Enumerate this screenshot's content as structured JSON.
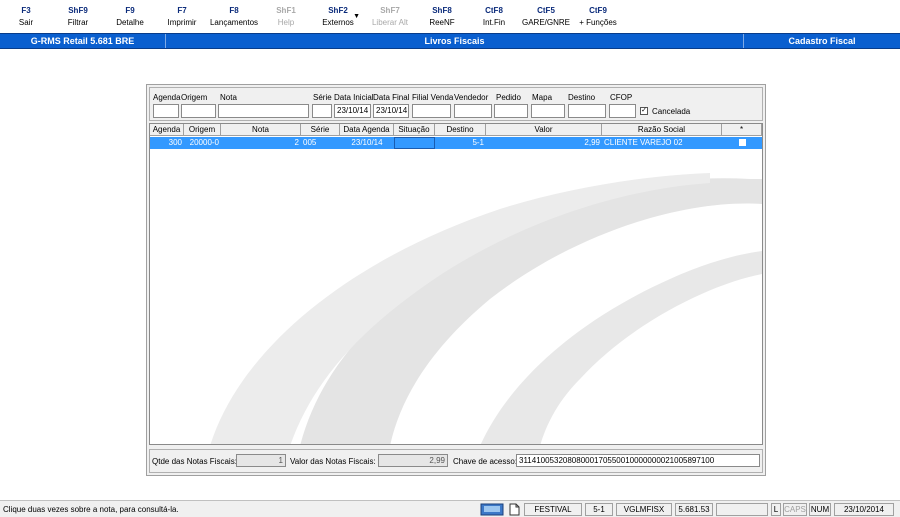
{
  "toolbar": [
    {
      "key": "F3",
      "label": "Sair",
      "enabled": true,
      "name": "sair-button"
    },
    {
      "key": "ShF9",
      "label": "Filtrar",
      "enabled": true,
      "name": "filtrar-button"
    },
    {
      "key": "F9",
      "label": "Detalhe",
      "enabled": true,
      "name": "detalhe-button"
    },
    {
      "key": "F7",
      "label": "Imprimir",
      "enabled": true,
      "name": "imprimir-button"
    },
    {
      "key": "F8",
      "label": "Lançamentos",
      "enabled": true,
      "name": "lancamentos-button"
    },
    {
      "key": "ShF1",
      "label": "Help",
      "enabled": false,
      "name": "help-button"
    },
    {
      "key": "ShF2",
      "label": "Externos",
      "enabled": true,
      "name": "externos-button",
      "dropdown": true
    },
    {
      "key": "ShF7",
      "label": "Liberar Alt",
      "enabled": false,
      "name": "liberar-alt-button"
    },
    {
      "key": "ShF8",
      "label": "ReeNF",
      "enabled": true,
      "name": "reenf-button"
    },
    {
      "key": "CtF8",
      "label": "Int.Fin",
      "enabled": true,
      "name": "int-fin-button"
    },
    {
      "key": "CtF5",
      "label": "GARE/GNRE",
      "enabled": true,
      "name": "gare-gnre-button"
    },
    {
      "key": "CtF9",
      "label": "+ Funções",
      "enabled": true,
      "name": "mais-funcoes-button"
    }
  ],
  "header": {
    "app": "G-RMS Retail 5.681 BRE",
    "title": "Livros Fiscais",
    "section": "Cadastro Fiscal"
  },
  "filters": {
    "agenda": {
      "label": "Agenda",
      "value": ""
    },
    "origem": {
      "label": "Origem",
      "value": ""
    },
    "nota": {
      "label": "Nota",
      "value": ""
    },
    "serie": {
      "label": "Série",
      "value": ""
    },
    "data_inicial": {
      "label": "Data Inicial",
      "value": "23/10/14"
    },
    "data_final": {
      "label": "Data Final",
      "value": "23/10/14"
    },
    "filial_venda": {
      "label": "Filial Venda",
      "value": ""
    },
    "vendedor": {
      "label": "Vendedor",
      "value": ""
    },
    "pedido": {
      "label": "Pedido",
      "value": ""
    },
    "mapa": {
      "label": "Mapa",
      "value": ""
    },
    "destino": {
      "label": "Destino",
      "value": ""
    },
    "cfop": {
      "label": "CFOP",
      "value": ""
    },
    "cancelada": {
      "label": "Cancelada",
      "checked": true,
      "mark": "✓"
    }
  },
  "grid": {
    "columns": [
      "Agenda",
      "Origem",
      "Nota",
      "Série",
      "Data Agenda",
      "Situação",
      "Destino",
      "Valor",
      "Razão Social",
      "*"
    ],
    "rows": [
      {
        "agenda": "300",
        "origem": "20000-0",
        "nota": "2",
        "serie": "005",
        "data_agenda": "23/10/14",
        "situacao": "",
        "destino": "5-1",
        "valor": "2,99",
        "razao_social": "CLIENTE VAREJO 02"
      }
    ]
  },
  "footer": {
    "qtde_label": "Qtde das Notas Fiscais:",
    "qtde_value": "1",
    "valor_label": "Valor  das Notas Fiscais:",
    "valor_value": "2,99",
    "chave_label": "Chave de acesso:",
    "chave_value": "31141005320808000170550010000000021005897100"
  },
  "status": {
    "message": "Clique duas vezes sobre a nota, para consultá-la.",
    "user": "FESTIVAL",
    "filial": "5-1",
    "program": "VGLMFISX",
    "version": "5.681.53",
    "blank": "",
    "l": "L",
    "caps": "CAPS",
    "num": "NUM",
    "date": "23/10/2014"
  }
}
